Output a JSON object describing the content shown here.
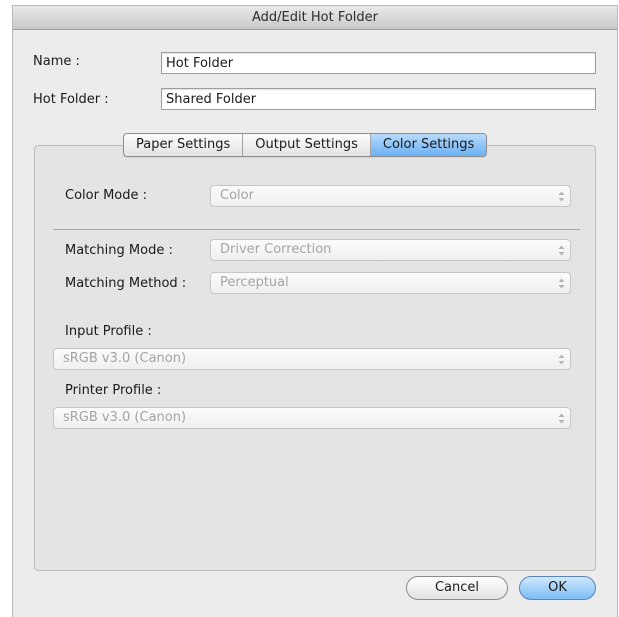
{
  "window": {
    "title": "Add/Edit Hot Folder"
  },
  "form": {
    "name_label": "Name :",
    "name_value": "Hot Folder",
    "hot_folder_label": "Hot Folder :",
    "hot_folder_value": "Shared Folder"
  },
  "tabs": [
    {
      "label": "Paper Settings",
      "active": false
    },
    {
      "label": "Output Settings",
      "active": false
    },
    {
      "label": "Color Settings",
      "active": true
    }
  ],
  "color_settings": {
    "color_mode_label": "Color Mode :",
    "color_mode_value": "Color",
    "matching_mode_label": "Matching Mode :",
    "matching_mode_value": "Driver Correction",
    "matching_method_label": "Matching Method :",
    "matching_method_value": "Perceptual",
    "input_profile_label": "Input Profile :",
    "input_profile_value": "sRGB v3.0 (Canon)",
    "printer_profile_label": "Printer Profile :",
    "printer_profile_value": "sRGB v3.0 (Canon)"
  },
  "buttons": {
    "cancel": "Cancel",
    "ok": "OK"
  },
  "colors": {
    "accent": "#7bbcf6",
    "disabled_text": "#a4a4a4"
  },
  "icons": {
    "popup_arrows": "updown-arrows-icon"
  }
}
